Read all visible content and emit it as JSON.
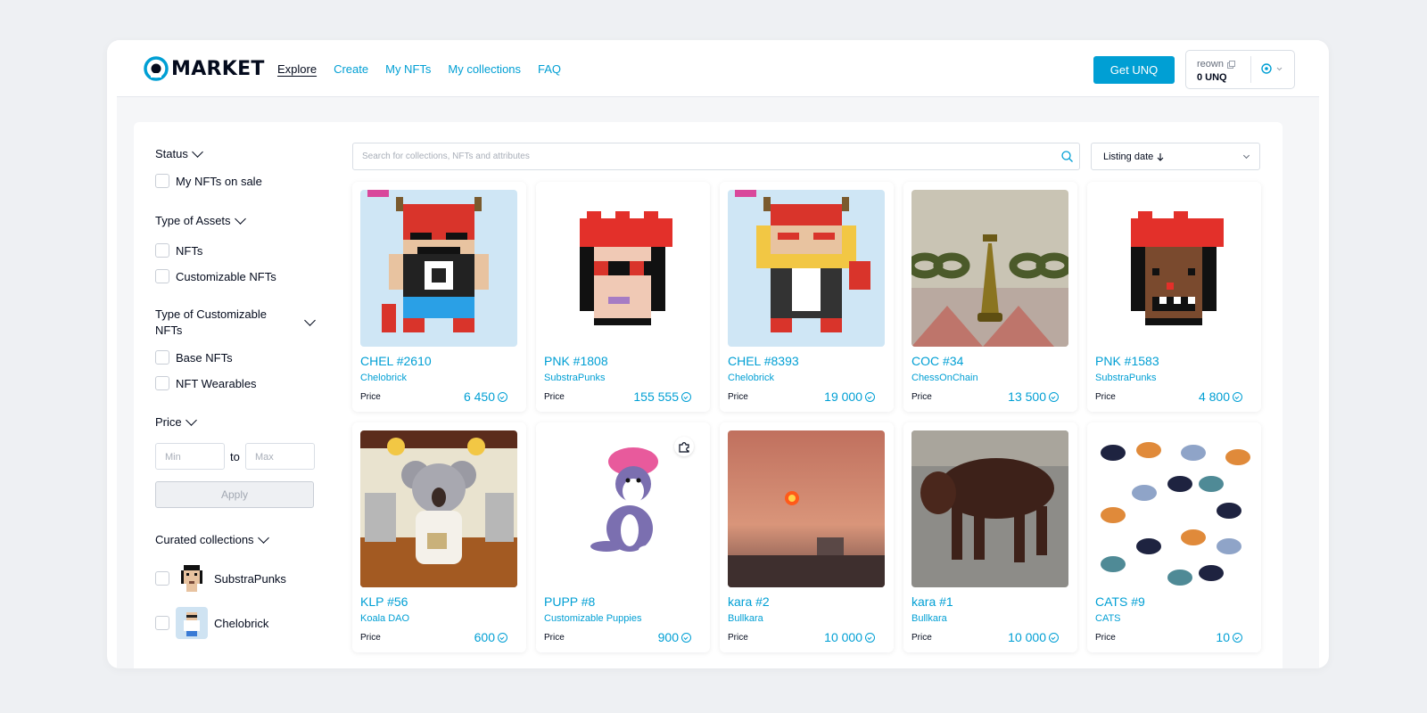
{
  "header": {
    "logo_text": "MARKET",
    "nav": [
      {
        "label": "Explore",
        "active": true
      },
      {
        "label": "Create"
      },
      {
        "label": "My NFTs"
      },
      {
        "label": "My collections"
      },
      {
        "label": "FAQ"
      }
    ],
    "get_button": "Get UNQ",
    "account": {
      "name": "reown",
      "balance": "0 UNQ"
    }
  },
  "filters": {
    "status": {
      "title": "Status",
      "options": [
        "My NFTs on sale"
      ]
    },
    "asset_type": {
      "title": "Type of Assets",
      "options": [
        "NFTs",
        "Customizable NFTs"
      ]
    },
    "custom_type": {
      "title": "Type of Customizable NFTs",
      "options": [
        "Base NFTs",
        "NFT Wearables"
      ]
    },
    "price": {
      "title": "Price",
      "min_placeholder": "Min",
      "to": "to",
      "max_placeholder": "Max",
      "apply": "Apply"
    },
    "curated": {
      "title": "Curated collections",
      "items": [
        "SubstraPunks",
        "Chelobrick"
      ]
    }
  },
  "search": {
    "placeholder": "Search for collections, NFTs and attributes"
  },
  "sort": {
    "label": "Listing date"
  },
  "price_label": "Price",
  "cards": [
    {
      "title": "CHEL #2610",
      "collection": "Chelobrick",
      "price": "6 450"
    },
    {
      "title": "PNK #1808",
      "collection": "SubstraPunks",
      "price": "155 555"
    },
    {
      "title": "CHEL #8393",
      "collection": "Chelobrick",
      "price": "19 000"
    },
    {
      "title": "COC #34",
      "collection": "ChessOnChain",
      "price": "13 500"
    },
    {
      "title": "PNK #1583",
      "collection": "SubstraPunks",
      "price": "4 800"
    },
    {
      "title": "KLP #56",
      "collection": "Koala DAO",
      "price": "600"
    },
    {
      "title": "PUPP #8",
      "collection": "Customizable Puppies",
      "price": "900"
    },
    {
      "title": "kara #2",
      "collection": "Bullkara",
      "price": "10 000"
    },
    {
      "title": "kara #1",
      "collection": "Bullkara",
      "price": "10 000"
    },
    {
      "title": "CATS #9",
      "collection": "CATS",
      "price": "10"
    }
  ],
  "colors": {
    "accent": "#009fd4",
    "text": "#040b1d",
    "page_bg": "#eef0f3"
  }
}
